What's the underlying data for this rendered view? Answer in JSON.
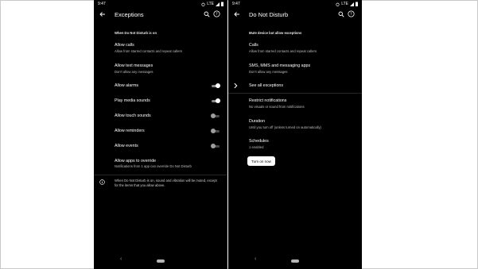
{
  "status_bar": {
    "time": "9:47",
    "network": "LTE"
  },
  "left": {
    "title": "Exceptions",
    "section_header": "When Do Not Disturb is on",
    "rows": [
      {
        "title": "Allow calls",
        "subtitle": "Allow from starred contacts and repeat callers"
      },
      {
        "title": "Allow text messages",
        "subtitle": "Don't allow any messages"
      },
      {
        "title": "Allow alarms",
        "subtitle": "",
        "toggle": "on"
      },
      {
        "title": "Play media sounds",
        "subtitle": "",
        "toggle": "on"
      },
      {
        "title": "Allow touch sounds",
        "subtitle": "",
        "toggle": "off"
      },
      {
        "title": "Allow reminders",
        "subtitle": "",
        "toggle": "off"
      },
      {
        "title": "Allow events",
        "subtitle": "",
        "toggle": "off"
      },
      {
        "title": "Allow apps to override",
        "subtitle": "Notifications from 1 app can override Do Not Disturb"
      }
    ],
    "info_text": "When Do Not Disturb is on, sound and vibration will be muted, except for the items that you allow above."
  },
  "right": {
    "title": "Do Not Disturb",
    "section_header": "Mute device but allow exceptions",
    "rows": [
      {
        "title": "Calls",
        "subtitle": "Allow from starred contacts and repeat callers"
      },
      {
        "title": "SMS, MMS and messaging apps",
        "subtitle": "Don't allow any messages"
      },
      {
        "title": "See all exceptions",
        "subtitle": ""
      },
      {
        "title": "Restrict notifications",
        "subtitle": "No visuals or sound from notifications"
      },
      {
        "title": "Duration",
        "subtitle": "Until you turn off (unless turned on automatically)"
      },
      {
        "title": "Schedules",
        "subtitle": "1 enabled"
      }
    ],
    "button_label": "Turn on now"
  },
  "icons": {
    "back": "back-arrow-icon",
    "search": "search-icon",
    "help": "help-icon",
    "info": "info-icon",
    "chevron": "chevron-right-icon"
  },
  "colors": {
    "background": "#000000",
    "text": "#ffffff",
    "subtext": "#bdbdbd",
    "button": "#ffffff"
  }
}
